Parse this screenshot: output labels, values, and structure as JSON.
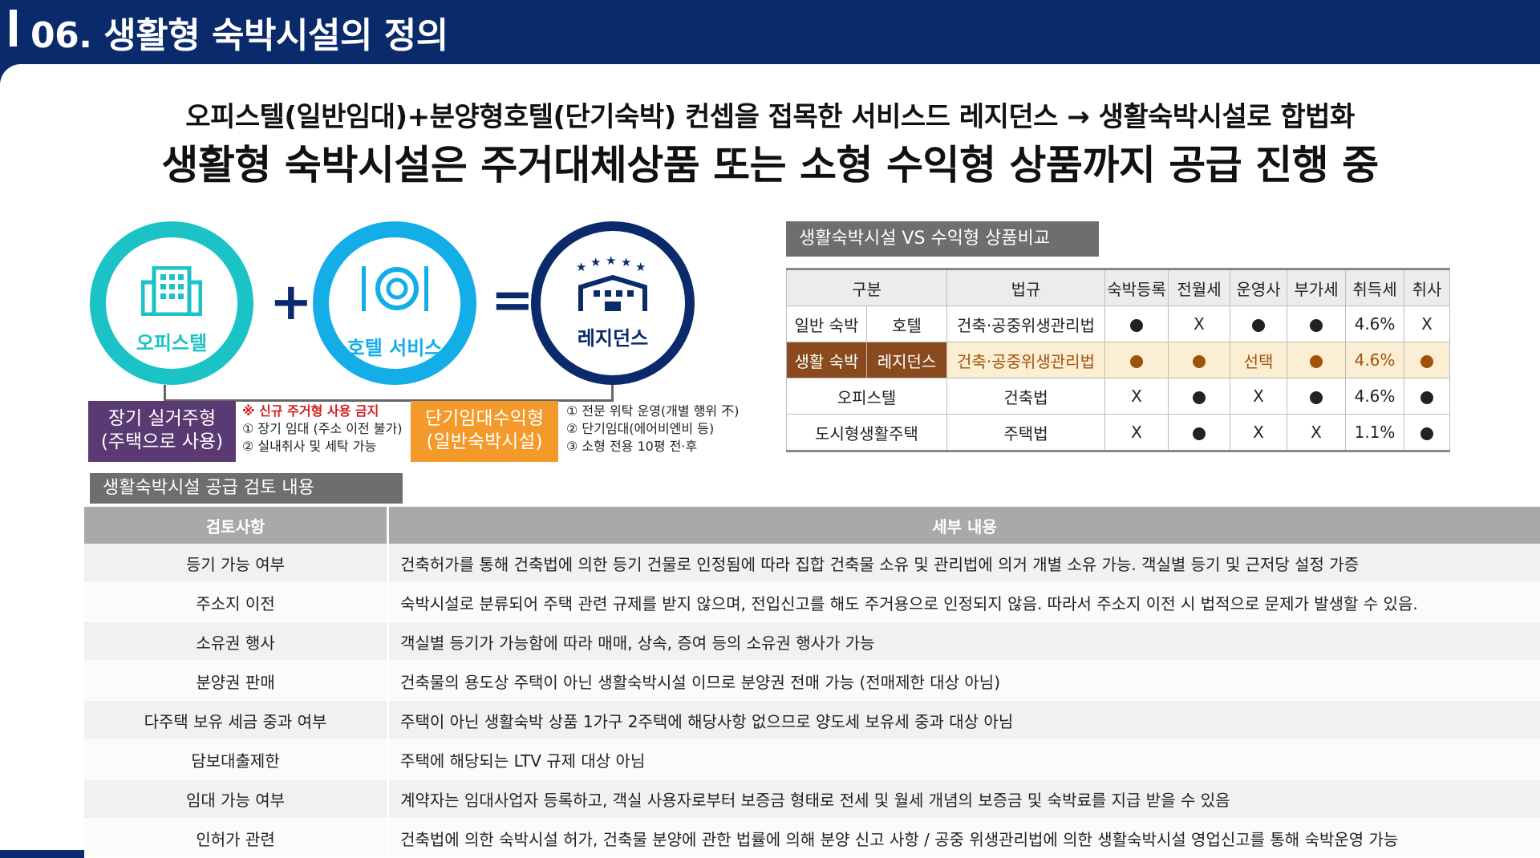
{
  "header": {
    "title": "06. 생활형 숙박시설의 정의"
  },
  "headline": {
    "line1": "오피스텔(일반임대)+분양형호텔(단기숙박) 컨셉을 접목한 서비스드 레지던스 → 생활숙박시설로 합법화",
    "line2": "생활형 숙박시설은 주거대체상품 또는 소형 수익형 상품까지 공급 진행 중"
  },
  "concept": {
    "circle1": "오피스텔",
    "circle2": "호텔 서비스",
    "circle3": "레지던스",
    "plus": "+",
    "equals": "=",
    "box_left": {
      "line1": "장기 실거주형",
      "line2": "(주택으로 사용)"
    },
    "notes_left": [
      "※ 신규 주거형 사용 금지",
      "① 장기 임대 (주소 이전 불가)",
      "② 실내취사 및 세탁 가능"
    ],
    "box_right": {
      "line1": "단기임대수익형",
      "line2": "(일반숙박시설)"
    },
    "notes_right": [
      "① 전문 위탁 운영(개별 행위 不)",
      "② 단기임대(에어비엔비 등)",
      "③ 소형 전용 10평 전·후"
    ]
  },
  "comparison": {
    "title": "생활숙박시설 VS 수익형 상품비교",
    "headers": [
      "구분",
      "법규",
      "숙박등록",
      "전월세",
      "운영사",
      "부가세",
      "취득세",
      "취사"
    ],
    "rows": [
      {
        "g1": "일반 숙박",
        "g2": "호텔",
        "law": "건축·공중위생관리법",
        "cells": [
          "●",
          "X",
          "●",
          "●",
          "4.6%",
          "X"
        ]
      },
      {
        "g1": "생활 숙박",
        "g2": "레지던스",
        "law": "건축·공중위생관리법",
        "cells": [
          "●",
          "●",
          "선택",
          "●",
          "4.6%",
          "●"
        ]
      },
      {
        "g": "오피스텔",
        "law": "건축법",
        "cells": [
          "X",
          "●",
          "X",
          "●",
          "4.6%",
          "●"
        ]
      },
      {
        "g": "도시형생활주택",
        "law": "주택법",
        "cells": [
          "X",
          "●",
          "X",
          "X",
          "1.1%",
          "●"
        ]
      }
    ]
  },
  "review": {
    "title": "생활숙박시설 공급 검토 내용",
    "headers": [
      "검토사항",
      "세부 내용"
    ],
    "rows": [
      {
        "k": "등기 가능 여부",
        "v": "건축허가를 통해 건축법에 의한 등기 건물로 인정됨에 따라 집합 건축물 소유 및 관리법에 의거 개별 소유 가능. 객실별 등기 및 근저당 설정 가증"
      },
      {
        "k": "주소지 이전",
        "v": "숙박시설로 분류되어 주택 관련 규제를 받지 않으며, 전입신고를 해도 주거용으로 인정되지 않음. 따라서 주소지 이전 시 법적으로 문제가 발생할 수 있음."
      },
      {
        "k": "소유권 행사",
        "v": "객실별 등기가 가능함에 따라 매매, 상속, 증여 등의 소유권 행사가 가능"
      },
      {
        "k": "분양권 판매",
        "v": "건축물의 용도상 주택이 아닌 생활숙박시설 이므로 분양권 전매 가능 (전매제한 대상 아님)"
      },
      {
        "k": "다주택 보유 세금 중과 여부",
        "v": "주택이 아닌 생활숙박 상품 1가구 2주택에 해당사항 없으므로 양도세 보유세 중과 대상 아님"
      },
      {
        "k": "담보대출제한",
        "v": "주택에 해당되는 LTV 규제 대상 아님"
      },
      {
        "k": "임대 가능 여부",
        "v": "계약자는 임대사업자 등록하고, 객실 사용자로부터 보증금 형태로 전세 및 월세 개념의 보증금 및 숙박료를 지급 받을 수 있음"
      },
      {
        "k": "인허가 관련",
        "v": "건축법에 의한 숙박시설 허가, 건축물 분양에 관한 법률에 의해 분양 신고 사항 / 공중 위생관리법에 의한 생활숙박시설 영업신고를 통해 숙박운영 가능"
      }
    ]
  },
  "colors": {
    "navy": "#0b2a6b",
    "teal": "#1bc3c6",
    "cyan": "#13aee8",
    "purple": "#5a3a72",
    "orange": "#f39a2a",
    "brown": "#8a4a1e"
  }
}
